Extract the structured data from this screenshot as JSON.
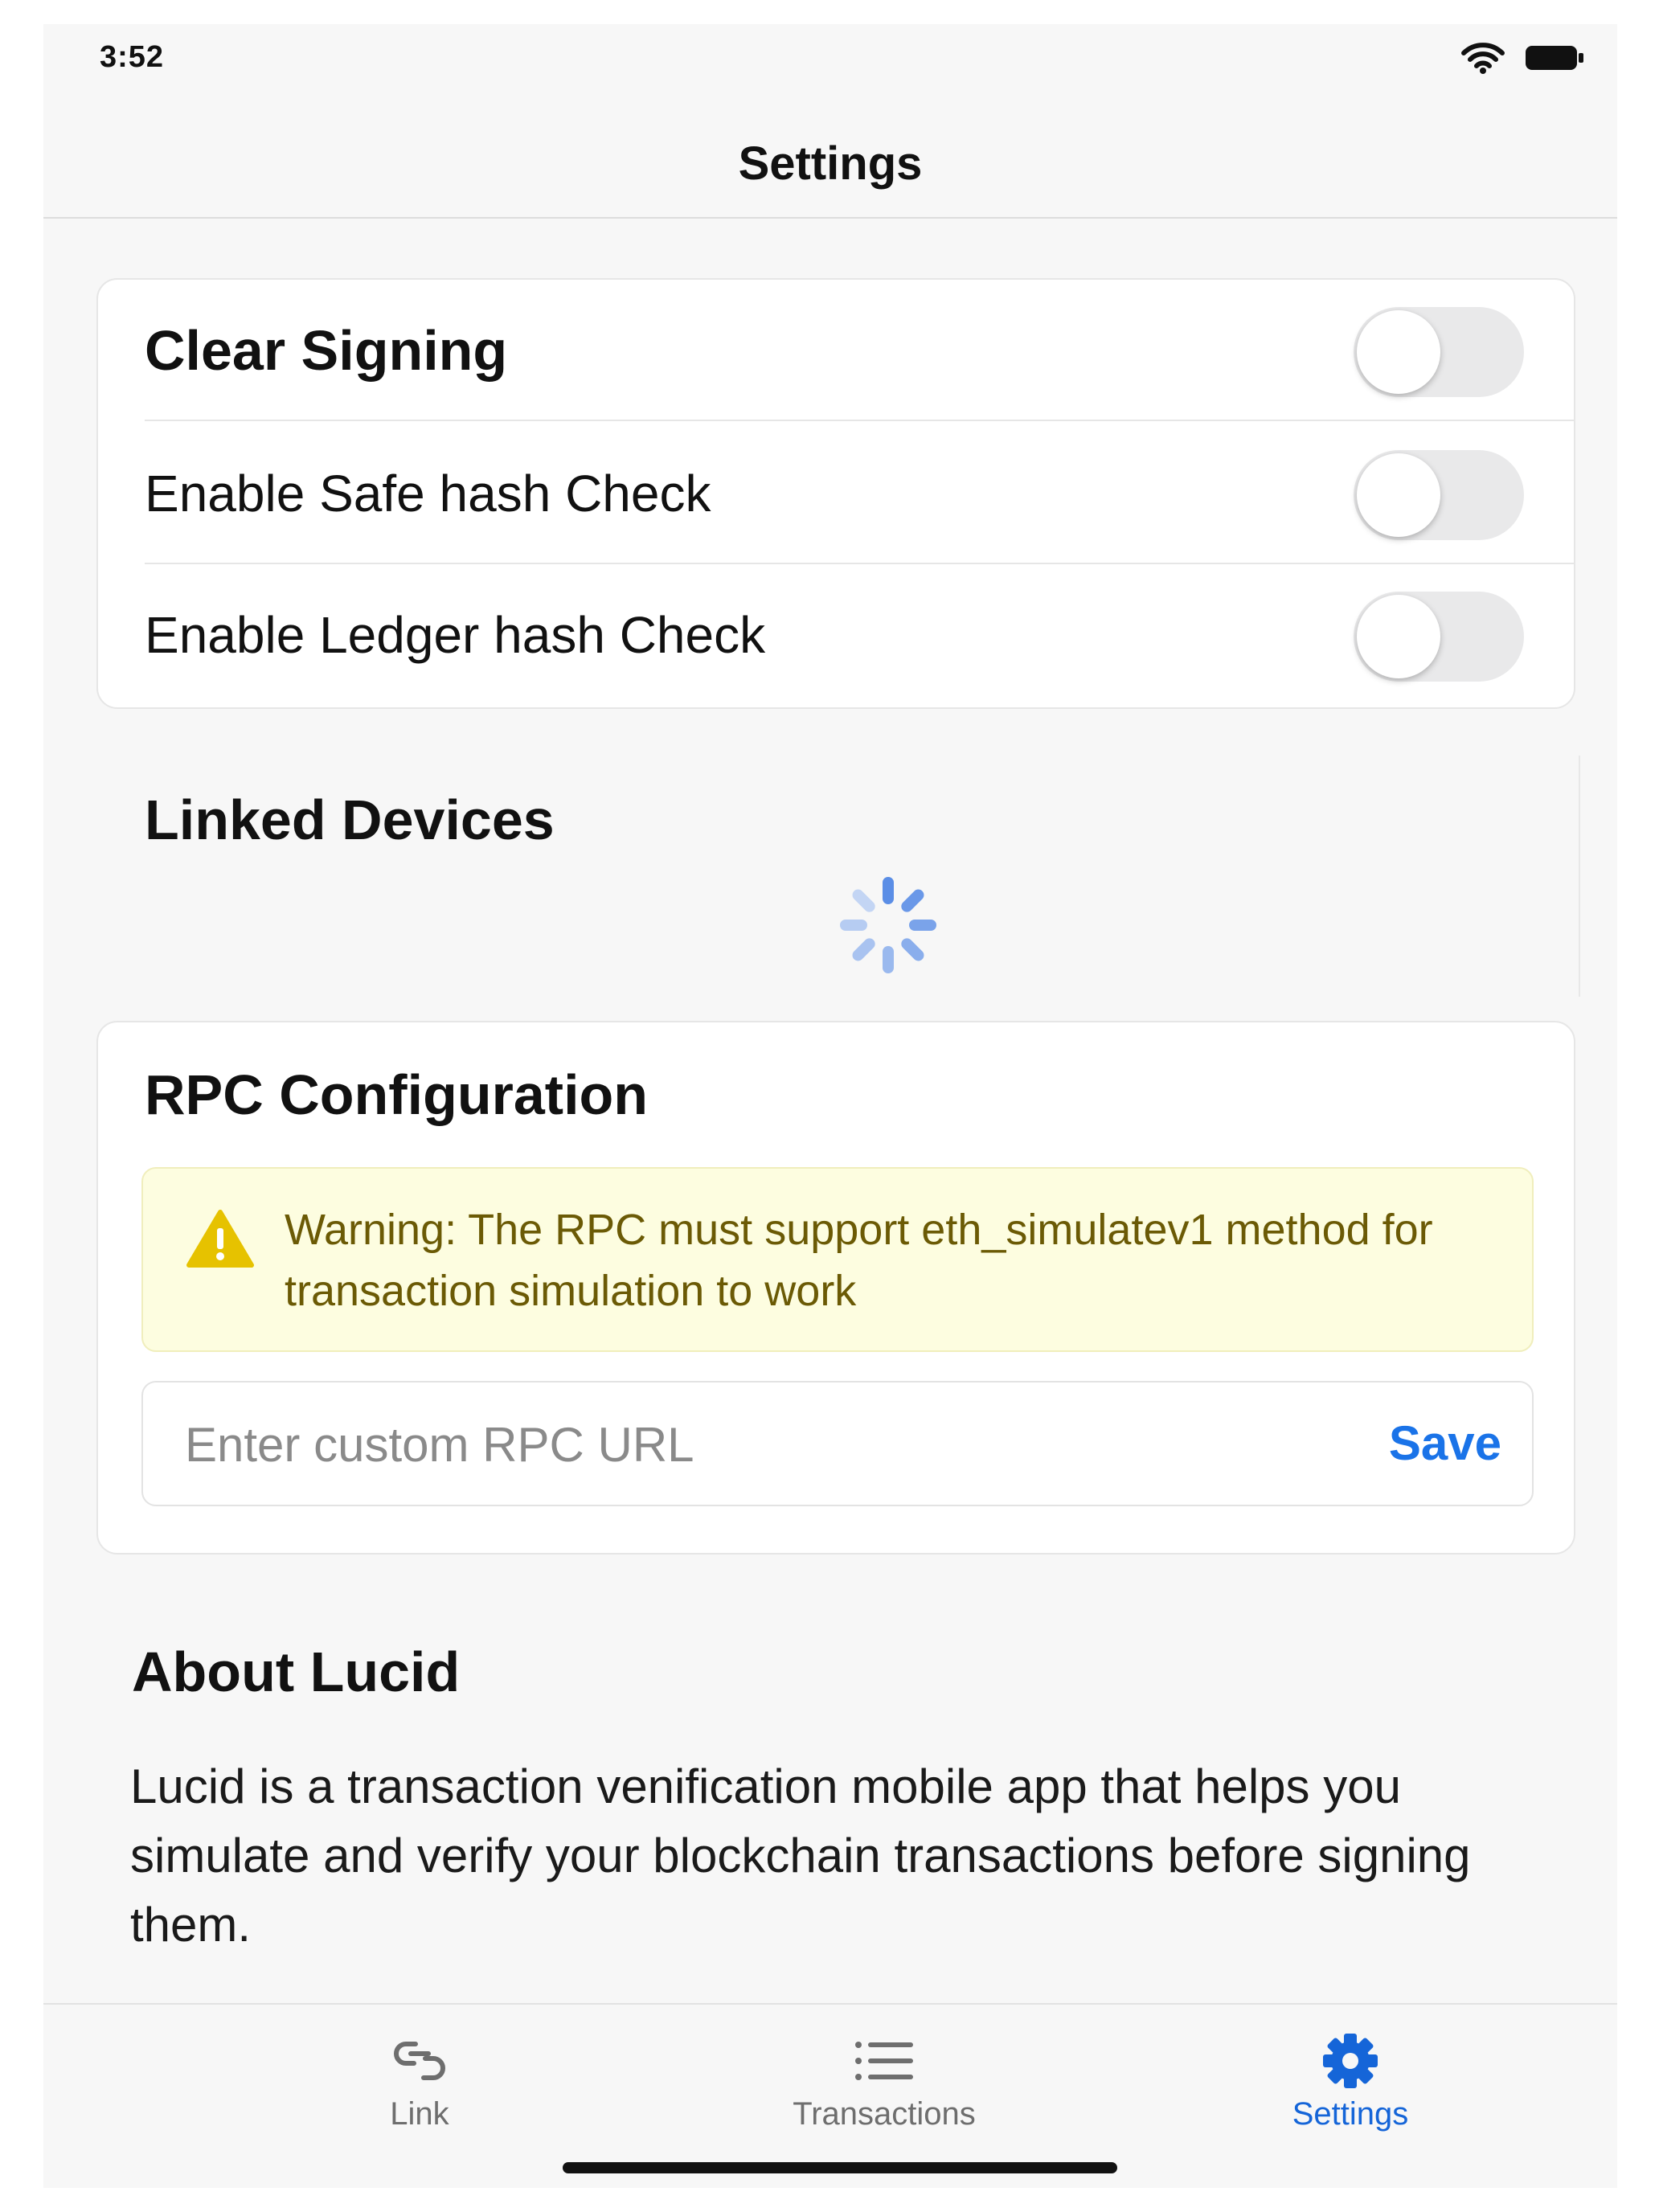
{
  "status_bar": {
    "time": "3:52",
    "icons": [
      "wifi-icon",
      "battery-icon"
    ]
  },
  "header": {
    "title": "Settings"
  },
  "toggles": [
    {
      "label": "Clear Signing",
      "on": false
    },
    {
      "label": "Enable Safe hash Check",
      "on": false
    },
    {
      "label": "Enable Ledger hash Check",
      "on": false
    }
  ],
  "linked_devices": {
    "title": "Linked Devices",
    "loading": true
  },
  "rpc": {
    "title": "RPC Configuration",
    "warning": "Warning: The RPC must support eth_simulatev1 method for transaction simulation to work",
    "input_value": "",
    "placeholder": "Enter custom RPC URL",
    "save_label": "Save"
  },
  "about": {
    "title": "About Lucid",
    "text": "Lucid is a transaction venification mobile app that helps you simulate and verify your blockchain transactions before signing them."
  },
  "tabs": [
    {
      "label": "Link",
      "icon": "link-icon",
      "active": false
    },
    {
      "label": "Transactions",
      "icon": "list-icon",
      "active": false
    },
    {
      "label": "Settings",
      "icon": "gear-icon",
      "active": true
    }
  ],
  "colors": {
    "accent": "#1a73e8",
    "active_tab": "#1565d8",
    "warning_bg": "#fdfde0",
    "warning_text": "#6b5a05",
    "warning_icon": "#e6c200",
    "spinner": "#8ab0ec",
    "switch_off": "#e9e9ea"
  }
}
